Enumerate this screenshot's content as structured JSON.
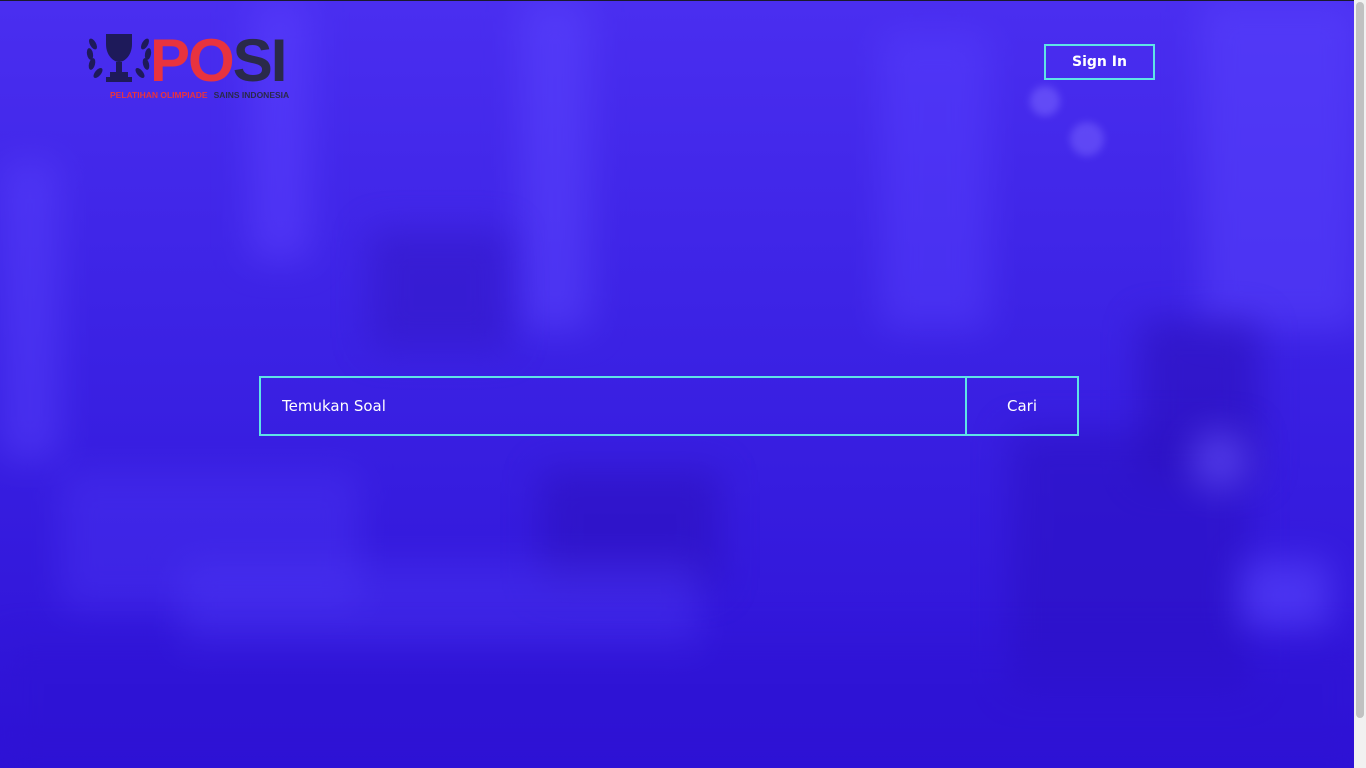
{
  "header": {
    "logo": {
      "word_part1": "PO",
      "word_part2": "SI",
      "tagline_part1": "PELATIHAN OLIMPIADE",
      "tagline_part2": "SAINS INDONESIA",
      "icon": "trophy-laurel-icon"
    },
    "signin_label": "Sign In"
  },
  "search": {
    "placeholder": "Temukan Soal",
    "value": "",
    "button_label": "Cari"
  },
  "colors": {
    "background": "#3a1fe0",
    "accent_border": "#5fe3e6",
    "logo_red": "#e8333f",
    "logo_dark": "#2a2a4a",
    "text": "#ffffff"
  }
}
